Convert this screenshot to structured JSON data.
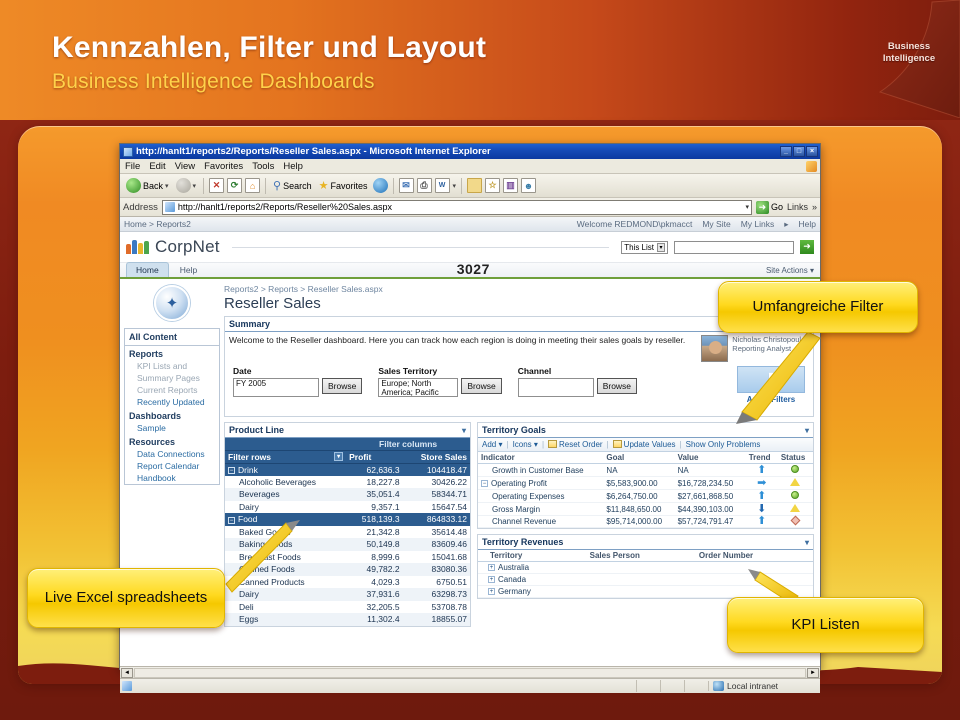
{
  "slide": {
    "title": "Kennzahlen, Filter und Layout",
    "subtitle": "Business Intelligence Dashboards",
    "badge_line1": "Business",
    "badge_line2": "Intelligence",
    "accent_orange": "#ef8a23",
    "accent_yellow": "#ffd24a",
    "accent_darkred": "#7d1d0e"
  },
  "callouts": [
    {
      "id": "filter",
      "text": "Umfangreiche Filter"
    },
    {
      "id": "excel",
      "text": "Live Excel spreadsheets"
    },
    {
      "id": "kpi",
      "text": "KPI Listen"
    }
  ],
  "browser": {
    "title": "http://hanlt1/reports2/Reports/Reseller Sales.aspx - Microsoft Internet Explorer",
    "window_buttons": [
      "_",
      "□",
      "×"
    ],
    "menus": [
      "File",
      "Edit",
      "View",
      "Favorites",
      "Tools",
      "Help"
    ],
    "toolbar": {
      "back": "Back",
      "stop": "✕",
      "refresh": "⟳",
      "home": "⌂",
      "search": "Search",
      "favorites": "Favorites"
    },
    "address": {
      "label": "Address",
      "value": "http://hanlt1/reports2/Reports/Reseller%20Sales.aspx",
      "go": "Go",
      "links": "Links"
    },
    "status": {
      "zone": "Local intranet"
    }
  },
  "sharepoint": {
    "breadcrumb_top": "Home > Reports2",
    "welcome": "Welcome REDMOND\\pkmacct",
    "top_links": [
      "My Site",
      "My Links",
      "Help"
    ],
    "site_name": "CorpNet",
    "search_scope": "This List",
    "search_value": "",
    "tabs": [
      {
        "label": "Home",
        "active": true
      },
      {
        "label": "Help",
        "active": false
      }
    ],
    "site_actions": "Site Actions",
    "overlay_number": "3027"
  },
  "leftnav": {
    "all_content": "All Content",
    "groups": [
      {
        "title": "Reports",
        "links": [
          {
            "label": "KPI Lists and",
            "dim": true
          },
          {
            "label": "Summary Pages",
            "dim": true
          },
          {
            "label": "Current Reports",
            "dim": true
          },
          {
            "label": "Recently Updated",
            "dim": false
          }
        ]
      },
      {
        "title": "Dashboards",
        "links": [
          {
            "label": "Sample",
            "dim": false
          }
        ]
      },
      {
        "title": "Resources",
        "links": [
          {
            "label": "Data Connections",
            "dim": false
          },
          {
            "label": "Report Calendar",
            "dim": false
          },
          {
            "label": "Handbook",
            "dim": false
          }
        ]
      }
    ]
  },
  "page": {
    "breadcrumb": "Reports2 > Reports > Reseller Sales.aspx",
    "title": "Reseller Sales"
  },
  "summary": {
    "heading": "Summary",
    "text": "Welcome to the Reseller dashboard.  Here you can track how each region is doing in meeting their sales goals by reseller.",
    "analyst_name": "Nicholas Christopoulos",
    "analyst_role": "Reporting Analyst"
  },
  "filters": {
    "date": {
      "label": "Date",
      "value": "FY 2005",
      "button": "Browse"
    },
    "territory": {
      "label": "Sales Territory",
      "value": "Europe; North America; Pacific",
      "button": "Browse"
    },
    "channel": {
      "label": "Channel",
      "value": "",
      "button": "Browse"
    },
    "apply": "Apply Filters"
  },
  "product_line": {
    "heading": "Product Line",
    "filter_columns_label": "Filter columns",
    "columns": [
      "Filter rows",
      "Profit",
      "Store Sales"
    ],
    "rows": [
      {
        "label": "Drink",
        "level": 0,
        "profit": "62,636.3",
        "store_sales": "104418.47"
      },
      {
        "label": "Alcoholic Beverages",
        "level": 1,
        "profit": "18,227.8",
        "store_sales": "30426.22"
      },
      {
        "label": "Beverages",
        "level": 1,
        "profit": "35,051.4",
        "store_sales": "58344.71"
      },
      {
        "label": "Dairy",
        "level": 1,
        "profit": "9,357.1",
        "store_sales": "15647.54"
      },
      {
        "label": "Food",
        "level": 0,
        "profit": "518,139.3",
        "store_sales": "864833.12"
      },
      {
        "label": "Baked Goods",
        "level": 1,
        "profit": "21,342.8",
        "store_sales": "35614.48"
      },
      {
        "label": "Baking Goods",
        "level": 1,
        "profit": "50,149.8",
        "store_sales": "83609.46"
      },
      {
        "label": "Breakfast Foods",
        "level": 1,
        "profit": "8,999.6",
        "store_sales": "15041.68"
      },
      {
        "label": "Canned Foods",
        "level": 1,
        "profit": "49,782.2",
        "store_sales": "83080.36"
      },
      {
        "label": "Canned Products",
        "level": 1,
        "profit": "4,029.3",
        "store_sales": "6750.51"
      },
      {
        "label": "Dairy",
        "level": 1,
        "profit": "37,931.6",
        "store_sales": "63298.73"
      },
      {
        "label": "Deli",
        "level": 1,
        "profit": "32,205.5",
        "store_sales": "53708.78"
      },
      {
        "label": "Eggs",
        "level": 1,
        "profit": "11,302.4",
        "store_sales": "18855.07"
      }
    ]
  },
  "territory_goals": {
    "heading": "Territory Goals",
    "toolbar": [
      "Add",
      "Icons",
      "Reset Order",
      "Update Values",
      "Show Only Problems"
    ],
    "columns": [
      "Indicator",
      "Goal",
      "Value",
      "Trend",
      "Status"
    ],
    "rows": [
      {
        "indicator": "Growth in Customer Base",
        "goal": "NA",
        "value": "NA",
        "trend": "up",
        "status": "green",
        "level": 0,
        "expander": ""
      },
      {
        "indicator": "Operating Profit",
        "goal": "$5,583,900.00",
        "value": "$16,728,234.50",
        "trend": "right",
        "status": "yellow",
        "level": 0,
        "expander": "minus"
      },
      {
        "indicator": "Operating Expenses",
        "goal": "$6,264,750.00",
        "value": "$27,661,868.50",
        "trend": "up",
        "status": "green",
        "level": 1,
        "expander": ""
      },
      {
        "indicator": "Gross Margin",
        "goal": "$11,848,650.00",
        "value": "$44,390,103.00",
        "trend": "down",
        "status": "yellow",
        "level": 1,
        "expander": ""
      },
      {
        "indicator": "Channel Revenue",
        "goal": "$95,714,000.00",
        "value": "$57,724,791.47",
        "trend": "up",
        "status": "red",
        "level": 0,
        "expander": ""
      }
    ]
  },
  "territory_revenues": {
    "heading": "Territory Revenues",
    "columns": [
      "Territory",
      "Sales Person",
      "Order Number"
    ],
    "rows": [
      {
        "territory": "Australia"
      },
      {
        "territory": "Canada"
      },
      {
        "territory": "Germany"
      }
    ]
  }
}
